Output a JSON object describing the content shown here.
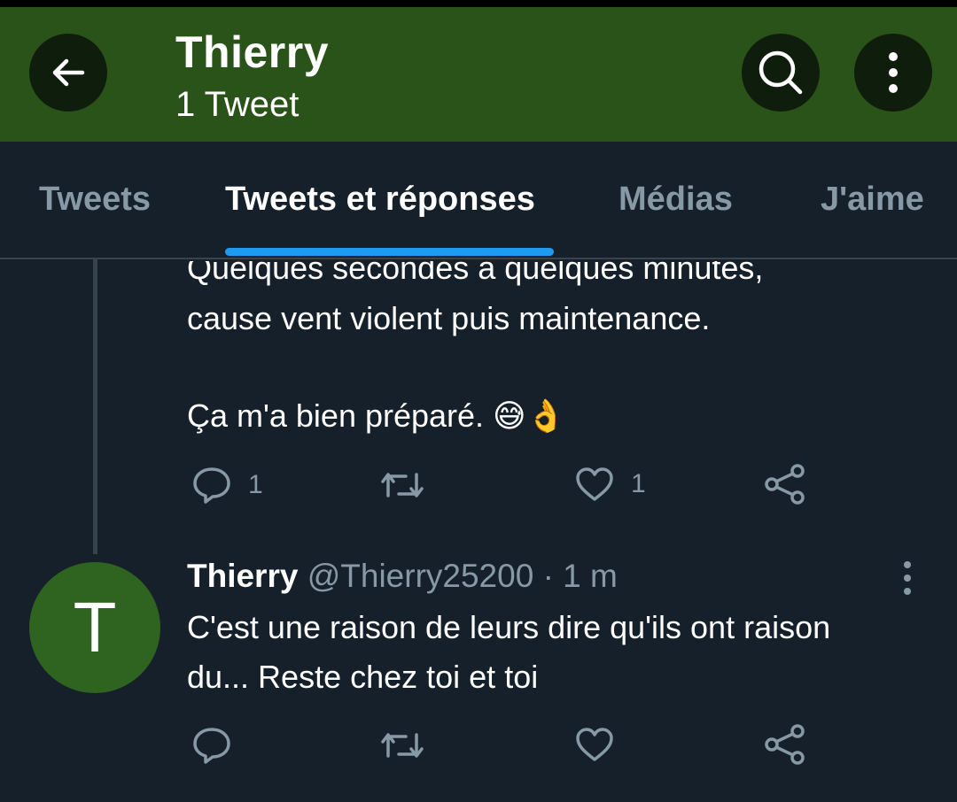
{
  "header": {
    "title": "Thierry",
    "subtitle": "1 Tweet",
    "colors": {
      "background": "#2a5319",
      "button_bg": "#0f1e0c"
    },
    "icons": [
      "back-arrow-icon",
      "search-icon",
      "more-vertical-icon"
    ]
  },
  "tabs": [
    {
      "label": "Tweets",
      "active": false
    },
    {
      "label": "Tweets et réponses",
      "active": true
    },
    {
      "label": "Médias",
      "active": false
    },
    {
      "label": "J'aime",
      "active": false
    }
  ],
  "tweet1": {
    "lines": [
      "Quelques secondes à quelques minutes,",
      "cause vent violent puis maintenance.",
      "Ça m'a bien préparé. 😅👌"
    ],
    "reply_count": "1",
    "like_count": "1"
  },
  "tweet2": {
    "avatar_letter": "T",
    "name": "Thierry",
    "handle": "@Thierry25200",
    "time": "· 1 m",
    "lines": [
      "C'est une raison de leurs dire qu'ils ont raison",
      "du... Reste chez toi et toi"
    ]
  },
  "colors": {
    "background": "#15202b",
    "muted": "#8899a6",
    "accent": "#1d9bf0",
    "avatar": "#2e6420"
  }
}
